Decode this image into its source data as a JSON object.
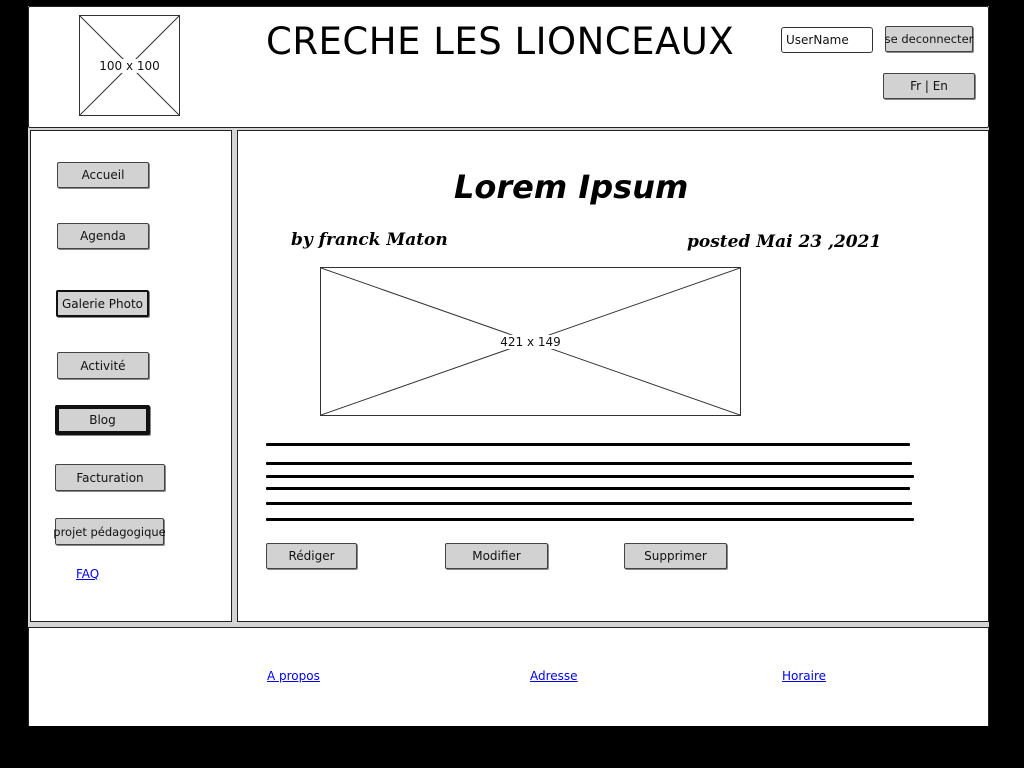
{
  "header": {
    "logo_placeholder": "100 x 100",
    "site_title": "CRECHE LES LIONCEAUX",
    "username": "UserName",
    "logout_label": "se deconnecter",
    "language_label": "Fr | En"
  },
  "sidebar": {
    "items": [
      {
        "label": "Accueil"
      },
      {
        "label": "Agenda"
      },
      {
        "label": "Galerie Photo"
      },
      {
        "label": "Activité"
      },
      {
        "label": "Blog"
      },
      {
        "label": "Facturation"
      },
      {
        "label": "projet pédagogique"
      }
    ],
    "faq_label": "FAQ",
    "active_item": "Blog"
  },
  "post": {
    "title": "Lorem Ipsum",
    "author": "by franck Maton",
    "date": "posted Mai 23 ,2021",
    "image_placeholder": "421 x 149"
  },
  "actions": {
    "write_label": "Rédiger",
    "edit_label": "Modifier",
    "delete_label": "Supprimer"
  },
  "footer": {
    "links": [
      {
        "label": "A propos"
      },
      {
        "label": "Adresse"
      },
      {
        "label": "Horaire"
      }
    ]
  }
}
